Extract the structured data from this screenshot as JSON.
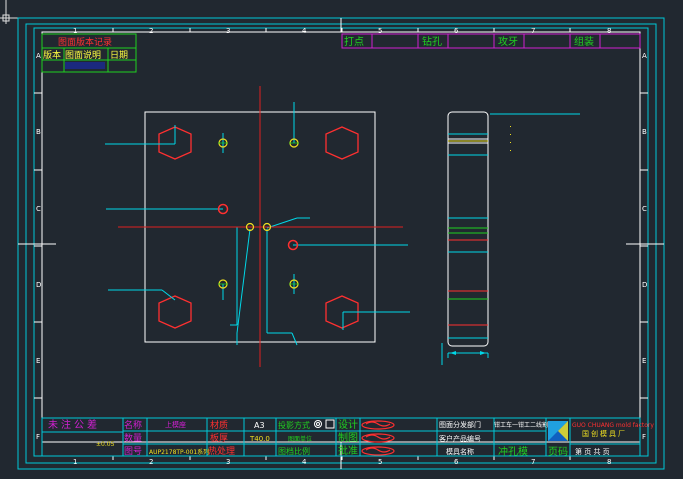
{
  "frame": {
    "top_cols": [
      "1",
      "2",
      "3",
      "4",
      "5",
      "6",
      "7",
      "8"
    ],
    "bottom_cols": [
      "1",
      "2",
      "3",
      "4",
      "5",
      "6",
      "7",
      "8"
    ],
    "left_rows": [
      "A",
      "B",
      "C",
      "D",
      "E",
      "F"
    ],
    "right_rows": [
      "A",
      "B",
      "C",
      "D",
      "E",
      "F"
    ]
  },
  "revision_table": {
    "title": "图面版本记录",
    "headers": [
      "版本",
      "图面说明",
      "日期"
    ]
  },
  "process_table": {
    "items": [
      "打点",
      "钻孔",
      "攻牙",
      "组装"
    ]
  },
  "title_block": {
    "untolerance": "未注公差",
    "tolerance_value": "±0.05",
    "name_label": "名称",
    "name_value": "上模座",
    "material_label": "材质",
    "material_value": "A3",
    "thickness_label": "板厚",
    "thickness_value": "T40.0",
    "drawing_no_label": "图号",
    "drawing_no_value": "AUP2178TP-001系列",
    "heat_label": "热处理",
    "projection_label": "投影方式",
    "units_label": "图面单位",
    "scale_label": "图档比例",
    "design_label": "设计",
    "draw_label": "制图",
    "approve_label": "批准",
    "issue_label": "图面分发部门",
    "issue_value": "钳工车一钳工二线割机加工",
    "customer_label": "客户产品编号",
    "mold_label": "模具名称",
    "mold_value": "冲孔模",
    "page_code": "页码",
    "page_text": "第  页  共  页",
    "company_en": "GUO CHUANG mold factory",
    "company_cn": "国创模具厂"
  }
}
